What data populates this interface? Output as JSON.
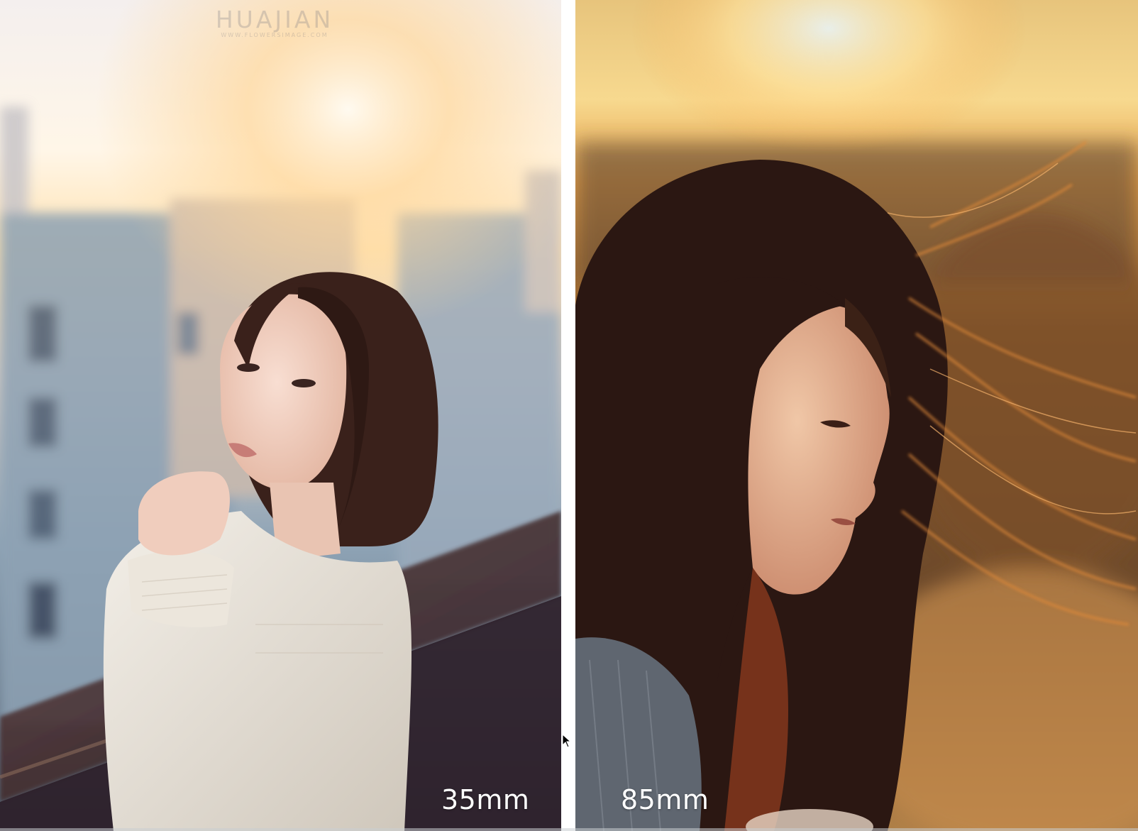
{
  "left_photo": {
    "focal_length_label": "35mm",
    "watermark": {
      "title": "HUAJIAN",
      "subtitle": "WWW.FLOWERSIMAGE.COM"
    }
  },
  "right_photo": {
    "focal_length_label": "85mm"
  },
  "colors": {
    "sky_glow": "#fff3d6",
    "sun_orange": "#f7b04a",
    "building_blue": "#7f9bb2",
    "hair_dark": "#2a1812",
    "sweater_cream": "#e7e0d5",
    "warm_backlight": "#d7892c"
  },
  "icons": {
    "cursor": "mouse-pointer-icon"
  }
}
